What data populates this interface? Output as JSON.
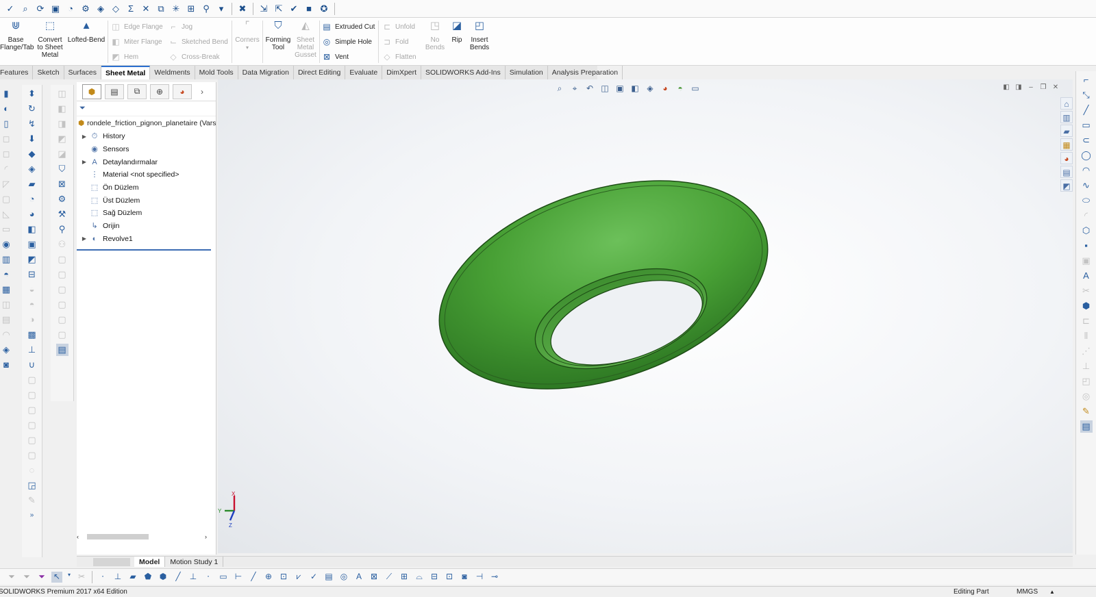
{
  "colors": {
    "part_green": "#4aa33a",
    "accent_blue": "#2b6fcf",
    "tree_divider": "#3b6cb3"
  },
  "top_toolbar": {
    "icons": [
      "spelling-icon",
      "zoom-icon",
      "rotate-icon",
      "sketch-icon",
      "measure-icon",
      "tools-icon",
      "check-icon",
      "evaluate-icon",
      "sum-icon",
      "mate-icon",
      "feature-icon",
      "split-icon",
      "pattern-icon",
      "options-icon",
      "more-icon",
      "delete-icon",
      "import-icon",
      "export-icon",
      "verify-icon",
      "plugin-icon",
      "settings-icon"
    ]
  },
  "ribbon": {
    "base_flange": "Base\nFlange/Tab",
    "convert": "Convert\nto Sheet\nMetal",
    "lofted_bend": "Lofted-Bend",
    "edge_flange": "Edge Flange",
    "miter_flange": "Miter Flange",
    "hem": "Hem",
    "jog": "Jog",
    "sketched_bend": "Sketched Bend",
    "cross_break": "Cross-Break",
    "corners": "Corners",
    "forming_tool": "Forming\nTool",
    "sheet_metal_gusset": "Sheet\nMetal\nGusset",
    "extruded_cut": "Extruded Cut",
    "simple_hole": "Simple Hole",
    "vent": "Vent",
    "unfold": "Unfold",
    "fold": "Fold",
    "flatten": "Flatten",
    "no_bends": "No\nBends",
    "rip": "Rip",
    "insert_bends": "Insert\nBends"
  },
  "tabs": [
    {
      "label": "Features",
      "active": false
    },
    {
      "label": "Sketch",
      "active": false
    },
    {
      "label": "Surfaces",
      "active": false
    },
    {
      "label": "Sheet Metal",
      "active": true
    },
    {
      "label": "Weldments",
      "active": false
    },
    {
      "label": "Mold Tools",
      "active": false
    },
    {
      "label": "Data Migration",
      "active": false
    },
    {
      "label": "Direct Editing",
      "active": false
    },
    {
      "label": "Evaluate",
      "active": false
    },
    {
      "label": "DimXpert",
      "active": false
    },
    {
      "label": "SOLIDWORKS Add-Ins",
      "active": false
    },
    {
      "label": "Simulation",
      "active": false
    },
    {
      "label": "Analysis Preparation",
      "active": false
    }
  ],
  "feature_tree": {
    "root": "rondele_friction_pignon_planetaire (Vars",
    "items": [
      {
        "label": "History",
        "icon": "history-icon",
        "expandable": true
      },
      {
        "label": "Sensors",
        "icon": "sensors-icon",
        "expandable": false
      },
      {
        "label": "Detaylandırmalar",
        "icon": "annotations-icon",
        "expandable": true
      },
      {
        "label": "Material <not specified>",
        "icon": "material-icon",
        "expandable": false
      },
      {
        "label": "Ön Düzlem",
        "icon": "plane-icon",
        "expandable": false
      },
      {
        "label": "Üst Düzlem",
        "icon": "plane-icon",
        "expandable": false
      },
      {
        "label": "Sağ Düzlem",
        "icon": "plane-icon",
        "expandable": false
      },
      {
        "label": "Orijin",
        "icon": "origin-icon",
        "expandable": false
      },
      {
        "label": "Revolve1",
        "icon": "revolve-icon",
        "expandable": true
      }
    ]
  },
  "triad": {
    "x": "X",
    "y": "Y",
    "z": "Z"
  },
  "model_tabs": [
    {
      "label": "Model",
      "active": true
    },
    {
      "label": "Motion Study 1",
      "active": false
    }
  ],
  "status": {
    "edition": "SOLIDWORKS Premium 2017 x64 Edition",
    "mode": "Editing Part",
    "units": "MMGS"
  }
}
